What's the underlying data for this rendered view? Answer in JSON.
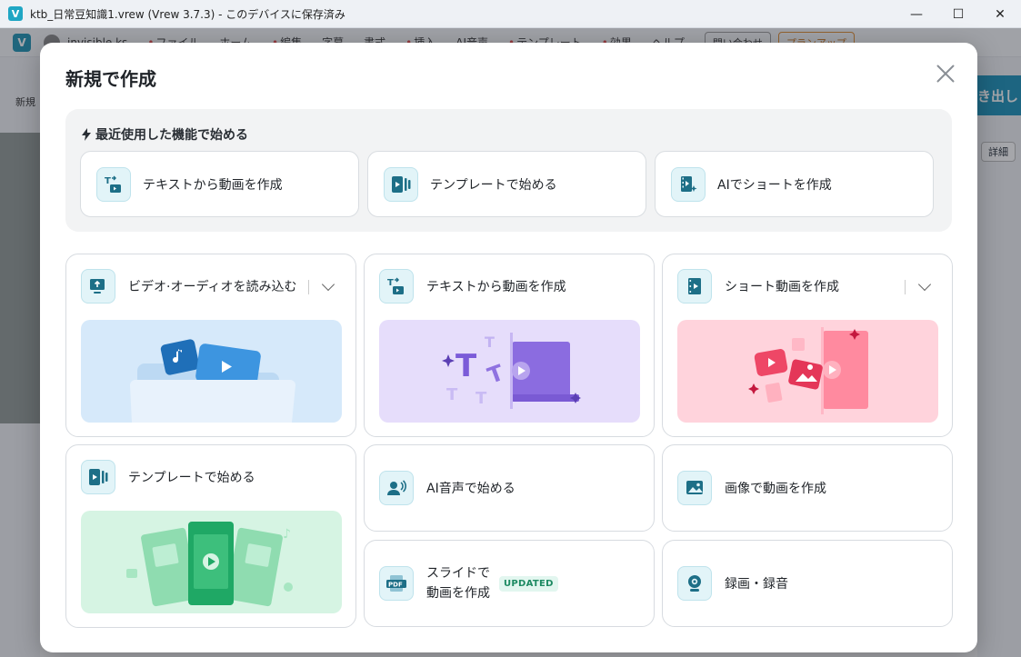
{
  "window": {
    "title": "ktb_日常豆知識1.vrew (Vrew 3.7.3) - このデバイスに保存済み",
    "app_icon": "V",
    "minimize": "—",
    "maximize": "☐",
    "close": "✕"
  },
  "app": {
    "menu": [
      "ファイル",
      "ホーム",
      "編集",
      "字幕",
      "書式",
      "挿入",
      "AI音声",
      "テンプレート",
      "効果",
      "ヘルプ"
    ],
    "user": "invisible.ks",
    "contact_button": "問い合わせ",
    "plan_button": "プランアップ",
    "export_button": "き出し",
    "detail_button": "詳細",
    "new_label": "新規"
  },
  "modal": {
    "title": "新規で作成",
    "recent": {
      "heading": "最近使用した機能で始める",
      "items": [
        {
          "label": "テキストから動画を作成",
          "icon": "text-to-video-icon"
        },
        {
          "label": "テンプレートで始める",
          "icon": "template-icon"
        },
        {
          "label": "AIでショートを作成",
          "icon": "ai-short-icon"
        }
      ]
    },
    "cards": {
      "import": {
        "label": "ビデオ·オーディオを読み込む",
        "icon": "import-video-icon"
      },
      "text_to_video": {
        "label": "テキストから動画を作成",
        "icon": "text-to-video-icon"
      },
      "short": {
        "label": "ショート動画を作成",
        "icon": "short-video-icon"
      },
      "template": {
        "label": "テンプレートで始める",
        "icon": "template-icon"
      },
      "ai_voice": {
        "label": "AI音声で始める",
        "icon": "ai-voice-icon"
      },
      "image_video": {
        "label": "画像で動画を作成",
        "icon": "image-icon"
      },
      "slide": {
        "line1": "スライドで",
        "line2": "動画を作成",
        "badge": "UPDATED",
        "icon": "pdf-icon"
      },
      "record": {
        "label": "録画・録音",
        "icon": "webcam-icon"
      }
    }
  },
  "colors": {
    "accent": "#1a8fb0",
    "icon_bg": "#e2f4f8",
    "import_illus_bg": "#d6e9fa",
    "text_illus_bg": "#e6ddfb",
    "short_illus_bg": "#ffd3dc",
    "template_illus_bg": "#d6f4e3"
  }
}
